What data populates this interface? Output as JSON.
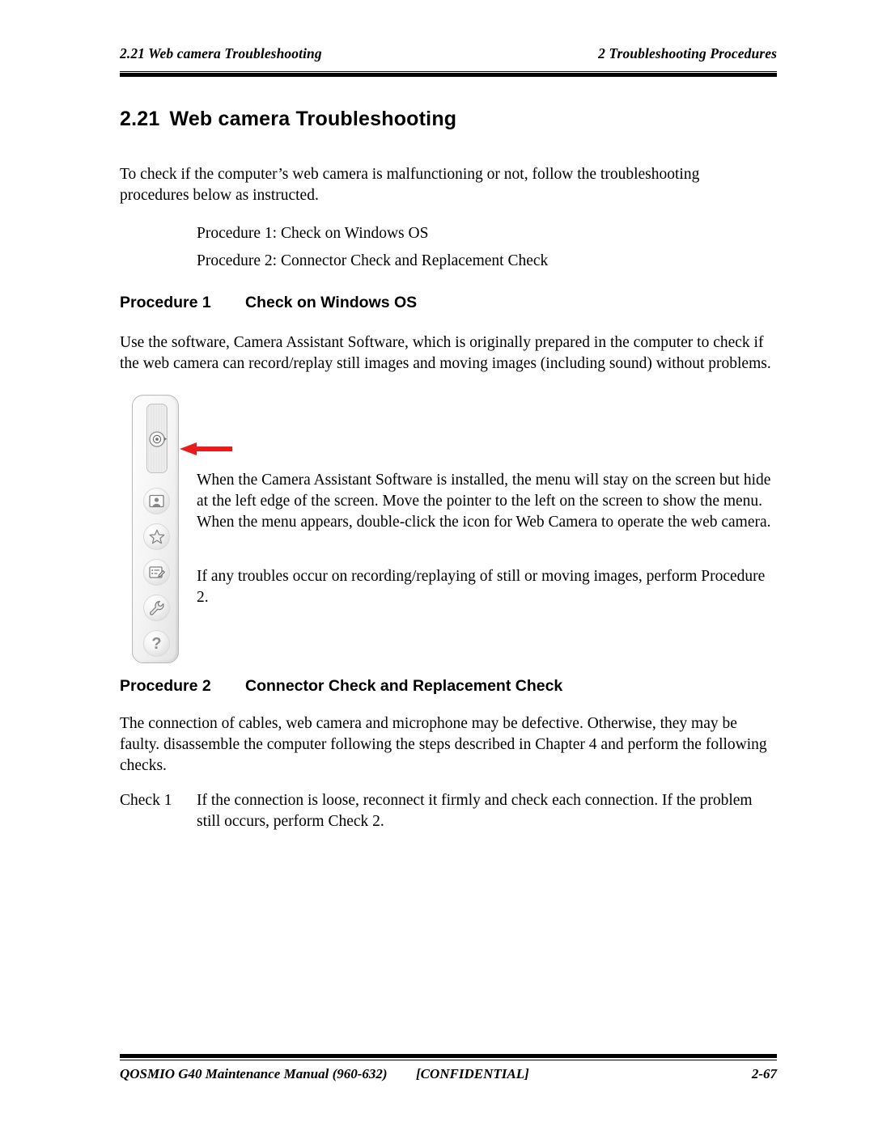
{
  "header": {
    "left": "2.21 Web camera Troubleshooting",
    "right": "2 Troubleshooting Procedures"
  },
  "section": {
    "number": "2.21",
    "title": "Web camera Troubleshooting"
  },
  "intro": {
    "paragraph": "To check if the computer’s web camera is malfunctioning or not, follow the troubleshooting procedures below as instructed.",
    "procedures": [
      {
        "label": "Procedure 1:",
        "text": "Check on Windows OS"
      },
      {
        "label": "Procedure 2:",
        "text": "Connector Check and Replacement Check"
      }
    ]
  },
  "procedure1": {
    "heading_number": "Procedure 1",
    "heading_title": "Check on Windows OS",
    "paragraph": "Use the software, Camera Assistant Software, which is originally prepared in the computer to check if the web camera can record/replay still images and moving images (including sound) without problems.",
    "figure_paragraph_1": "When the Camera Assistant Software is installed, the menu will stay on the screen but hide at the left edge of the screen. Move the pointer to the left on the screen to show the menu. When the menu appears, double-click the icon for Web Camera to operate the web camera.",
    "figure_paragraph_2": "If any troubles occur on recording/replaying of still or moving images, perform Procedure 2."
  },
  "figure": {
    "toolbar_label": "Web Camera",
    "arrow_color": "#e81c1c",
    "icons": [
      {
        "name": "web-camera-icon",
        "label": "Web Camera"
      },
      {
        "name": "photo-icon",
        "label": "Photo"
      },
      {
        "name": "star-icon",
        "label": "Favorites"
      },
      {
        "name": "edit-note-icon",
        "label": "Edit"
      },
      {
        "name": "wrench-icon",
        "label": "Settings"
      },
      {
        "name": "help-icon",
        "label": "?"
      }
    ]
  },
  "procedure2": {
    "heading_number": "Procedure 2",
    "heading_title": "Connector Check and Replacement Check",
    "paragraph": "The connection of cables, web camera and microphone may be defective. Otherwise, they may be faulty. disassemble the computer following the steps described in Chapter 4 and perform the following checks.",
    "checks": [
      {
        "label": "Check 1",
        "text": "If the connection is loose, reconnect it firmly and check each connection. If the problem still occurs, perform Check 2."
      }
    ]
  },
  "footer": {
    "left": "QOSMIO G40 Maintenance Manual (960-632)",
    "center": "[CONFIDENTIAL]",
    "right": "2-67"
  }
}
